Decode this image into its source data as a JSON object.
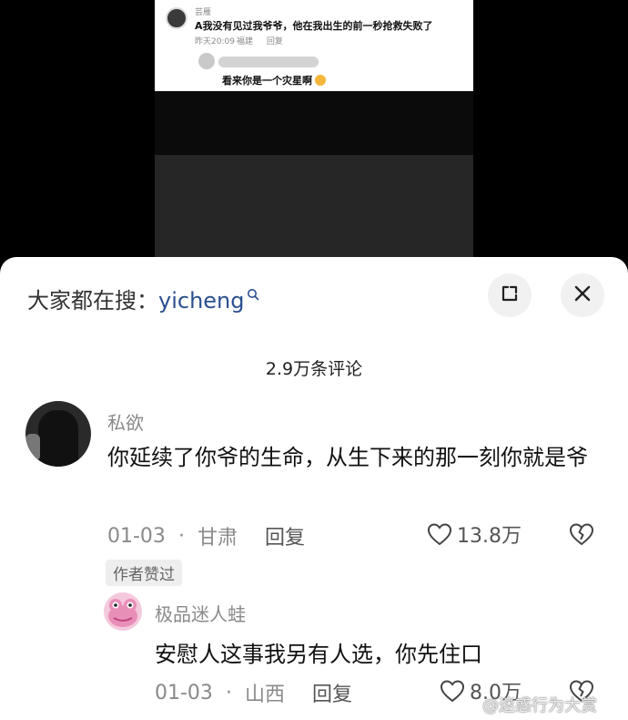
{
  "embedded_screenshot": {
    "username": "芸雁",
    "comment": "A我没有见过我爷爷，他在我出生的前一秒抢救失败了",
    "time": "昨天20:09",
    "location": "福建",
    "reply_label": "回复",
    "reply_text": "看来你是一个灾星啊"
  },
  "sheet": {
    "search_prefix": "大家都在搜：",
    "search_keyword": "yicheng",
    "comment_count": "2.9万条评论"
  },
  "comments": [
    {
      "username": "私欲",
      "text": "你延续了你爷的生命，从生下来的那一刻你就是爷",
      "date": "01-03",
      "location": "甘肃",
      "reply_label": "回复",
      "likes": "13.8万",
      "badge": "作者赞过"
    },
    {
      "username": "极品迷人蛙",
      "text": "安慰人这事我另有人选，你先住口",
      "date": "01-03",
      "location": "山西",
      "reply_label": "回复",
      "likes": "8.0万"
    }
  ],
  "watermark": "@迷惑行为大赏",
  "colors": {
    "keyword": "#2b4f8f",
    "sheet_bg": "#ffffff",
    "meta": "#8a8a8a"
  },
  "icons": [
    "search-icon",
    "expand-icon",
    "close-icon",
    "heart-icon",
    "broken-heart-icon"
  ]
}
